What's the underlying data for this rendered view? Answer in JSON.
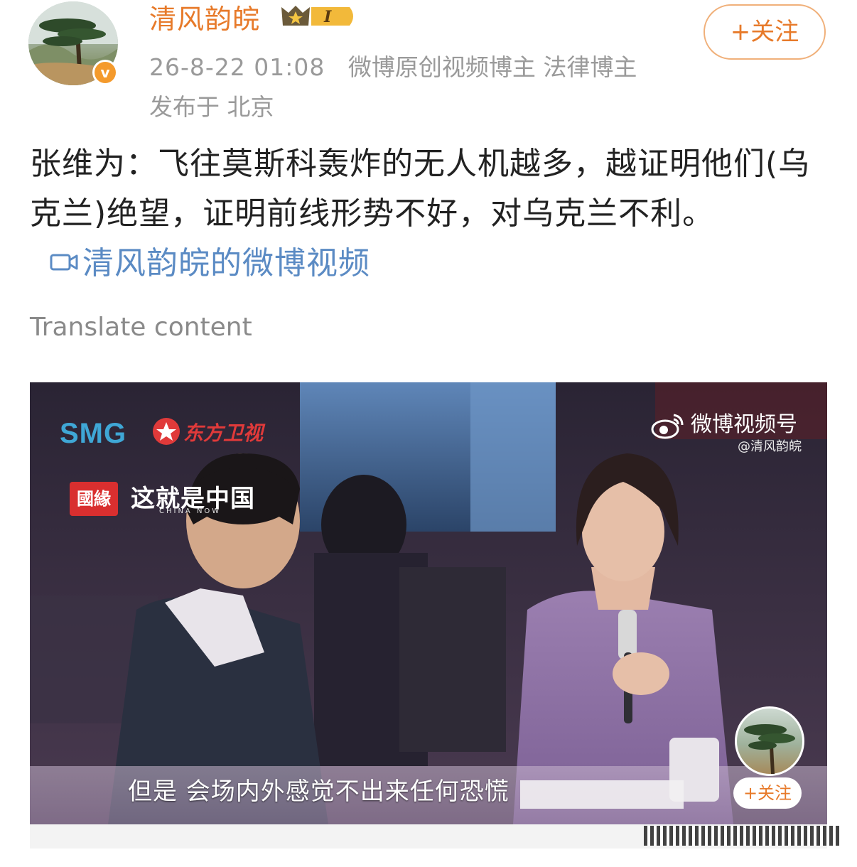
{
  "post": {
    "author": "清风韵皖",
    "verified": "v",
    "level_badge": "I",
    "follow_label": "+关注",
    "time": "26-8-22 01:08",
    "author_tags": "微博原创视频博主 法律博主",
    "location": "发布于 北京",
    "body": "张维为：飞往莫斯科轰炸的无人机越多，越证明他们(乌克兰)绝望，证明前线形势不好，对乌克兰不利。",
    "video_link": "清风韵皖的微博视频",
    "translate": "Translate content"
  },
  "video": {
    "smg_logo": "SMG",
    "channel": "东方卫视",
    "show_badge": "國緣",
    "show_title": "这就是中国",
    "show_subtitle": "CHINA NOW",
    "watermark_brand": "微博视频号",
    "watermark_handle": "@清风韵皖",
    "subtitle": "但是 会场内外感觉不出来任何恐慌",
    "mini_follow": "+关注"
  },
  "colors": {
    "author_orange": "#e77a2a",
    "link_blue": "#5b8bc4",
    "meta_gray": "#9a9a9a"
  },
  "icons": {
    "verified": "verified-v-icon",
    "level": "crown-level-icon",
    "video_link": "video-camera-icon",
    "weibo": "weibo-eye-icon"
  }
}
